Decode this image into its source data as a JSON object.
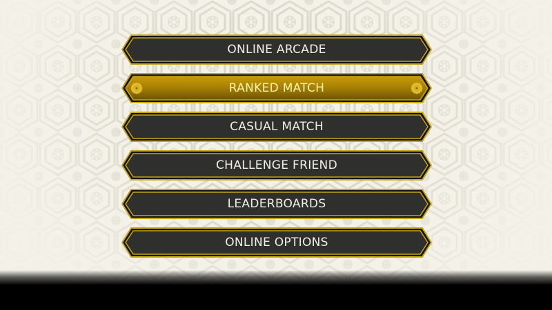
{
  "menu": {
    "items": [
      {
        "label": "ONLINE ARCADE",
        "selected": false
      },
      {
        "label": "RANKED MATCH",
        "selected": true
      },
      {
        "label": "CASUAL MATCH",
        "selected": false
      },
      {
        "label": "CHALLENGE FRIEND",
        "selected": false
      },
      {
        "label": "LEADERBOARDS",
        "selected": false
      },
      {
        "label": "ONLINE OPTIONS",
        "selected": false
      }
    ]
  },
  "colors": {
    "button_fill": "#2f2f2d",
    "button_border": "#c7a61a",
    "selected_fill": "#b38a06",
    "selected_text": "#fff6a8",
    "background": "#f4f2e8",
    "pattern": "#d9d6cb"
  },
  "icons": {
    "selected_decoration": "chrysanthemum-crest-icon",
    "background_pattern": "hexagon-crest-pattern"
  }
}
